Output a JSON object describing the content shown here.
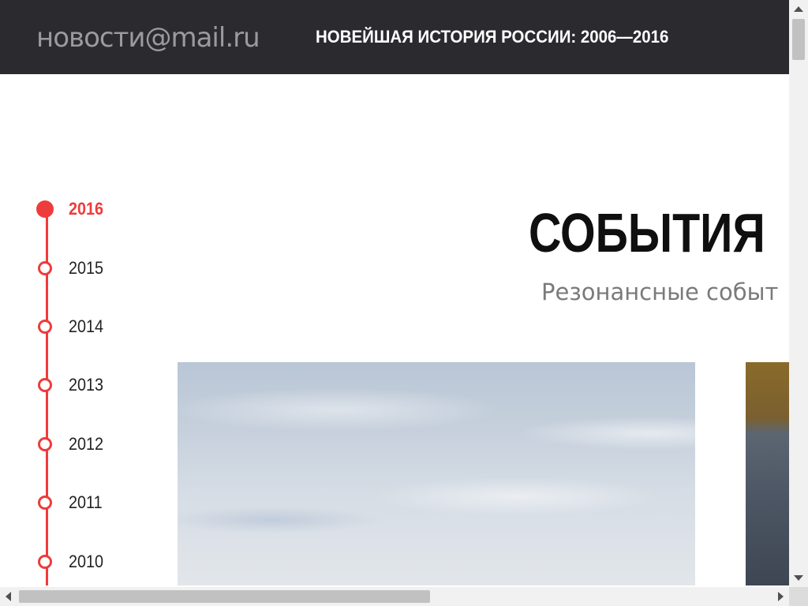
{
  "header": {
    "logo_text": "новости@mail.ru",
    "section_title": "НОВЕЙШАЯ ИСТОРИЯ РОССИИ: 2006—2016"
  },
  "timeline": {
    "active_color": "#ee3b3b",
    "years": [
      {
        "label": "2016",
        "active": true
      },
      {
        "label": "2015",
        "active": false
      },
      {
        "label": "2014",
        "active": false
      },
      {
        "label": "2013",
        "active": false
      },
      {
        "label": "2012",
        "active": false
      },
      {
        "label": "2011",
        "active": false
      },
      {
        "label": "2010",
        "active": false
      }
    ]
  },
  "main": {
    "title": "СОБЫТИЯ",
    "subtitle": "Резонансные событ"
  },
  "cards": [
    {
      "image": "sky-photo"
    },
    {
      "image": "partial-photo"
    }
  ],
  "scrollbars": {
    "vertical_thumb_position": 0.0,
    "horizontal_thumb_position": 0.0
  }
}
